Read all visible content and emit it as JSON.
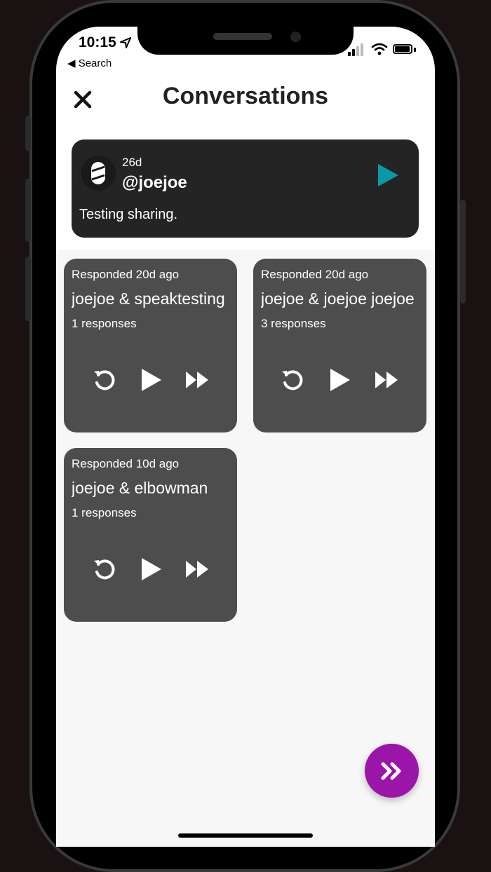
{
  "status_bar": {
    "time": "10:15",
    "back_label": "◀ Search"
  },
  "header": {
    "title": "Conversations"
  },
  "main_post": {
    "age": "26d",
    "handle": "@joejoe",
    "text": "Testing sharing."
  },
  "responses": [
    {
      "when": "Responded 20d ago",
      "names": " joejoe & speaktesting",
      "count": "1 responses"
    },
    {
      "when": "Responded 20d ago",
      "names": " joejoe & joejoe   joejoe",
      "count": "3 responses"
    },
    {
      "when": "Responded 10d ago",
      "names": "joejoe & elbowman",
      "count": "1 responses"
    }
  ],
  "icons": {
    "close": "close-icon",
    "play": "play-icon",
    "replay": "replay-icon",
    "fast_forward": "fast-forward-icon",
    "skip": "chevrons-right-icon"
  },
  "colors": {
    "accent_teal": "#0a9aa5",
    "fab_purple": "#9a15a8",
    "card_dark": "#242424",
    "card_gray": "#4d4d4d"
  }
}
